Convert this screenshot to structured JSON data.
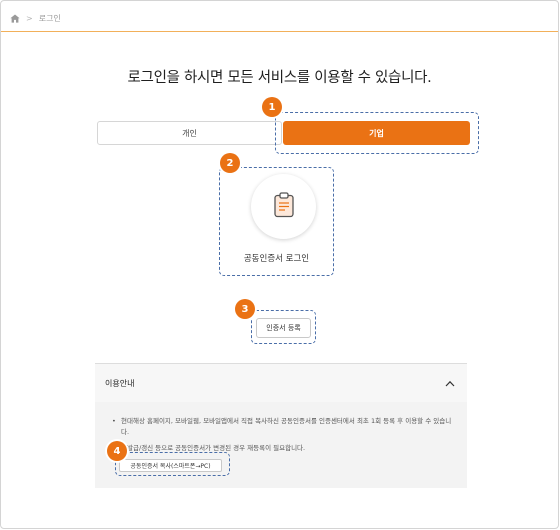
{
  "breadcrumb": {
    "home_icon": "home-icon",
    "separator": ">",
    "current": "로그인"
  },
  "page": {
    "title": "로그인을 하시면 모든 서비스를 이용할 수 있습니다."
  },
  "tabs": [
    {
      "label": "개인",
      "active": false
    },
    {
      "label": "기업",
      "active": true
    }
  ],
  "certificate": {
    "icon": "clipboard-icon",
    "label": "공동인증서 로그인"
  },
  "register_button": {
    "label": "인증서 등록"
  },
  "guide": {
    "title": "이용안내",
    "toggle_icon": "chevron-up-icon",
    "bullet": "•",
    "items": [
      "현대해상 홈페이지, 모바일웹, 모바일앱에서 직접 복사하신 공동인증서를 인증센터에서 최초 1회 등록 후 이용할 수 있습니다.",
      "재발급/갱신 등으로 공동인증서가 변경된 경우 재등록이 필요합니다."
    ],
    "copy_button": "공동인증서 복사(스마트폰→PC)"
  },
  "badges": [
    "1",
    "2",
    "3",
    "4"
  ],
  "colors": {
    "accent": "#ea7214",
    "highlight_border": "#4a6ea8",
    "top_line": "#f2b05a"
  }
}
